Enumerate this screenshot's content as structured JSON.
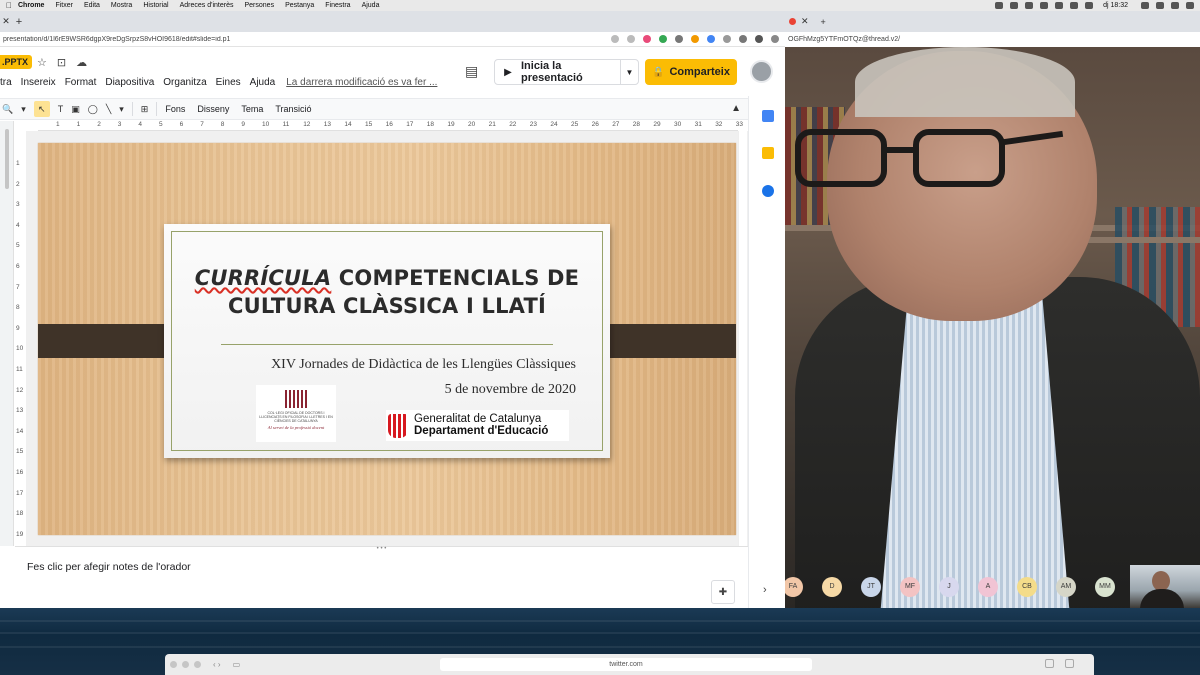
{
  "menubar": {
    "items": [
      "Chrome",
      "Fitxer",
      "Edita",
      "Mostra",
      "Historial",
      "Adreces d'interès",
      "Persones",
      "Pestanya",
      "Finestra",
      "Ajuda"
    ],
    "clock": "dj 18:32"
  },
  "left_window": {
    "url": "presentation/d/1l6rE9WSR6dgpX9reDgSrpzS8vHOI9618/edit#slide=id.p1",
    "file_badge": ".PPTX",
    "menus": [
      "tra",
      "Insereix",
      "Format",
      "Diapositiva",
      "Organitza",
      "Eines",
      "Ajuda"
    ],
    "last_edit": "La darrera modificació es va fer ...",
    "present_label": "Inicia la presentació",
    "share_label": "Comparteix",
    "toolbar_text": [
      "Fons",
      "Disseny",
      "Tema",
      "Transició"
    ],
    "ruler_h": [
      "1",
      "1",
      "2",
      "3",
      "4",
      "5",
      "6",
      "7",
      "8",
      "9",
      "10",
      "11",
      "12",
      "13",
      "14",
      "15",
      "16",
      "17",
      "18",
      "19",
      "20",
      "21",
      "22",
      "23",
      "24",
      "25",
      "26",
      "27",
      "28",
      "29",
      "30",
      "31",
      "32",
      "33"
    ],
    "ruler_v": [
      "1",
      "2",
      "3",
      "4",
      "5",
      "6",
      "7",
      "8",
      "9",
      "10",
      "11",
      "12",
      "13",
      "14",
      "15",
      "16",
      "17",
      "18",
      "19"
    ],
    "notes_placeholder": "Fes clic per afegir notes de l'orador"
  },
  "slide": {
    "title_italic": "CURRÍCULA",
    "title_rest_line1": " COMPETENCIALS DE",
    "title_line2": "CULTURA CLÀSSICA I LLATÍ",
    "subtitle": "XIV Jornades de Didàctica de les Llengües Clàssiques",
    "date": "5 de novembre de 2020",
    "logo1_text": "COL·LEGI OFICIAL DE DOCTORS I LLICENCIATS EN FILOSOFIA I LLETRES I EN CIÈNCIES DE CATALUNYA",
    "logo1_motto": "Al servei de la professió docent",
    "logo2_line1": "Generalitat de Catalunya",
    "logo2_line2": "Departament d'Educació"
  },
  "right_window": {
    "url": "OGFhMzg5YTFmOTQz@thread.v2/"
  },
  "participants": [
    "FA",
    "D",
    "JT",
    "MF",
    "J",
    "A",
    "CB",
    "AM",
    "MM"
  ],
  "participant_colors": [
    "#f2c7a8",
    "#f6d9a6",
    "#c9d6ea",
    "#f3c3c3",
    "#d8d8ee",
    "#f1c4d4",
    "#f4dc8a",
    "#d6d6c8",
    "#d9e3d0"
  ],
  "safari": {
    "url": "twitter.com"
  }
}
